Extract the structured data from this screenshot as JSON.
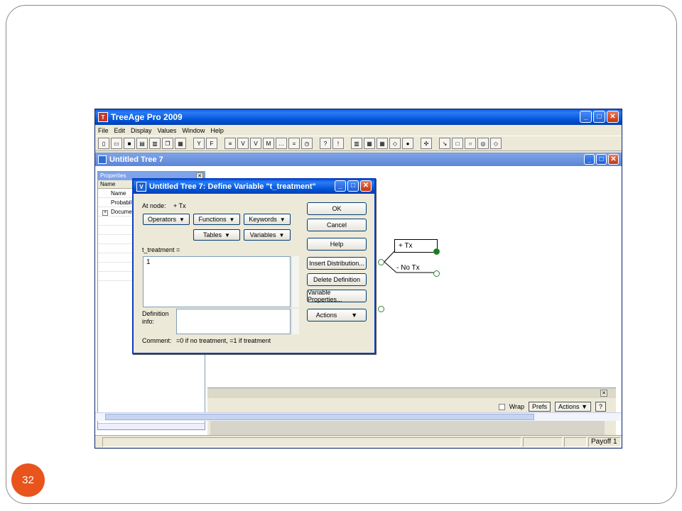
{
  "slide": {
    "number": "32"
  },
  "app": {
    "title": "TreeAge Pro 2009",
    "menu": [
      "File",
      "Edit",
      "Display",
      "Values",
      "Window",
      "Help"
    ],
    "toolbar_icons": [
      "new-icon",
      "open-icon",
      "save-icon",
      "print-icon",
      "print-preview-icon",
      "copy-icon",
      "paste-icon",
      "sep",
      "yn-icon",
      "fx-icon",
      "sep",
      "tree-icon",
      "v-icon",
      "vequals-icon",
      "m-icon",
      "dots-icon",
      "equals-icon",
      "clock-icon",
      "sep",
      "help-icon",
      "warning-icon",
      "sep",
      "chart-icon",
      "sens1-icon",
      "sens2-icon",
      "node-icon",
      "sphere-icon",
      "sep",
      "move-icon",
      "sep",
      "arrow-icon",
      "square-icon",
      "circle-icon",
      "circle2-icon",
      "diamond-icon"
    ]
  },
  "child": {
    "title": "Untitled Tree 7",
    "properties": {
      "title": "Properties",
      "header": "Name",
      "rows": [
        "Name",
        "Probabil",
        "Docume"
      ]
    },
    "tree": {
      "node_plus": "+ Tx",
      "node_minus": "- No Tx"
    },
    "lower": {
      "wrap_label": "Wrap",
      "prefs_label": "Prefs",
      "actions_label": "Actions",
      "help_label": "?"
    },
    "status": {
      "payoff": "Payoff 1"
    }
  },
  "dialog": {
    "title": "Untitled Tree 7: Define Variable \"t_treatment\"",
    "at_node_label": "At node:",
    "at_node_value": "+ Tx",
    "operators": "Operators",
    "functions": "Functions",
    "keywords": "Keywords",
    "tables": "Tables",
    "variables": "Variables",
    "var_expr_label": "t_treatment =",
    "expr_value": "1",
    "definition_info_label": "Definition\ninfo:",
    "comment_label": "Comment:",
    "comment_value": "=0 if no treatment, =1 if treatment",
    "ok": "OK",
    "cancel": "Cancel",
    "help": "Help",
    "insert_distribution": "Insert Distribution...",
    "delete_definition": "Delete Definition",
    "variable_properties": "Variable Properties...",
    "actions": "Actions"
  },
  "colors": {
    "xp_blue": "#0052d6",
    "accent_orange": "#e8541c",
    "node_green": "#1b7a1b"
  }
}
